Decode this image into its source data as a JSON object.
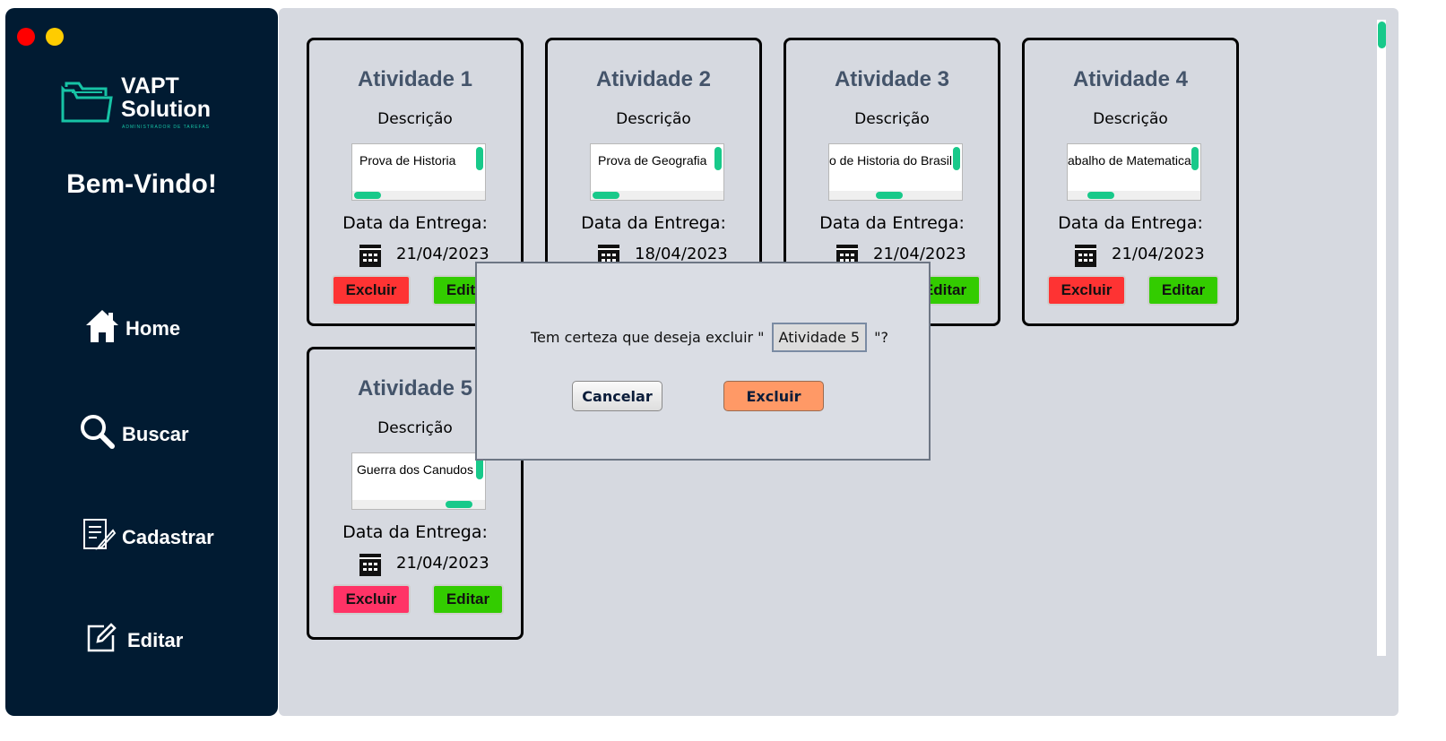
{
  "window": {
    "controls": [
      "close",
      "minimize"
    ]
  },
  "sidebar": {
    "logo": {
      "line1": "VAPT",
      "line2": "Solution",
      "tagline": "ADMINISTRADOR DE TAREFAS"
    },
    "welcome": "Bem-Vindo!",
    "nav": [
      {
        "label": "Home",
        "icon": "home-icon"
      },
      {
        "label": "Buscar",
        "icon": "search-icon"
      },
      {
        "label": "Cadastrar",
        "icon": "register-icon"
      },
      {
        "label": "Editar",
        "icon": "edit-icon"
      }
    ]
  },
  "common": {
    "desc_label": "Descrição",
    "date_label": "Data da Entrega:",
    "delete_label": "Excluir",
    "edit_label": "Editar"
  },
  "cards": [
    {
      "title": "Atividade 1",
      "description": "Prova de Historia",
      "date": "21/04/2023"
    },
    {
      "title": "Atividade 2",
      "description": "Prova de Geografia",
      "date": "18/04/2023"
    },
    {
      "title": "Atividade 3",
      "description": "o de Historia do Brasil",
      "date": "21/04/2023"
    },
    {
      "title": "Atividade 4",
      "description": "abalho de Matematica",
      "date": "21/04/2023"
    },
    {
      "title": "Atividade 5",
      "description": "Guerra dos Canudos",
      "date": "21/04/2023"
    }
  ],
  "dialog": {
    "prefix": "Tem certeza que deseja excluir \"",
    "target": "Atividade 5",
    "suffix": "\"?",
    "cancel_label": "Cancelar",
    "confirm_label": "Excluir"
  },
  "colors": {
    "sidebar_bg": "#011b32",
    "content_bg": "#d6d9e0",
    "accent": "#18c98a",
    "delete": "#fe3333",
    "delete_hover": "#ff3366",
    "edit": "#33cc00",
    "dialog_confirm": "#ff9966",
    "title": "#44546a"
  }
}
